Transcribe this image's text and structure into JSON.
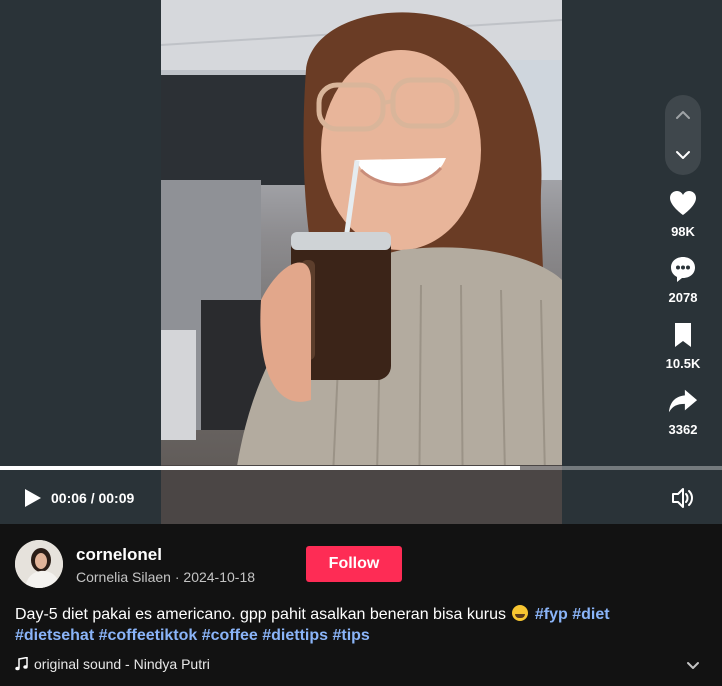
{
  "player": {
    "time_display": "00:06 / 00:09",
    "progress": 0.72
  },
  "actions": {
    "likes": "98K",
    "comments": "2078",
    "saves": "10.5K",
    "shares": "3362"
  },
  "author": {
    "username": "cornelonel",
    "display_name": "Cornelia Silaen",
    "date": "2024-10-18",
    "follow_label": "Follow"
  },
  "caption": {
    "text": "Day-5 diet pakai es americano. gpp pahit asalkan beneran bisa kurus",
    "hashtags": [
      "#fyp",
      "#diet",
      "#dietsehat",
      "#coffeetiktok",
      "#coffee",
      "#diettips",
      "#tips"
    ]
  },
  "sound": {
    "label": "original sound - Nindya Putri"
  },
  "colors": {
    "accent": "#fe2c55",
    "hashtag": "#8ab4f8",
    "background": "#121212",
    "player_bg": "#2a3338"
  },
  "icons": {
    "play": "play-icon",
    "volume": "volume-icon",
    "nav_up": "chevron-up-icon",
    "nav_down": "chevron-down-icon",
    "like": "heart-icon",
    "comment": "comment-icon",
    "save": "bookmark-icon",
    "share": "share-arrow-icon",
    "sound": "music-note-icon",
    "expand": "chevron-down-icon"
  }
}
